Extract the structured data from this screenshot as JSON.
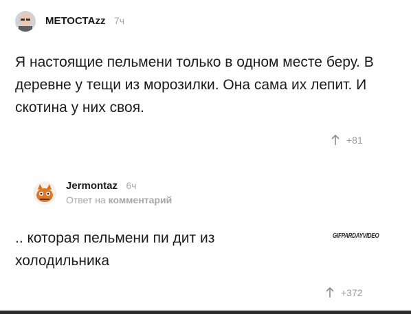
{
  "comments": [
    {
      "author": "МЕТОСТАzz",
      "time": "7ч",
      "text": "Я настоящие пельмени только в одном месте беру. В деревне у тещи из морозилки. Она сама их лепит. И скотина у них своя.",
      "votes": "+81",
      "avatar_icon": "bald-man-avatar-icon"
    },
    {
      "author": "Jermontaz",
      "time": "6ч",
      "reply_prefix": "Ответ на",
      "reply_target": "комментарий",
      "text": ".. которая пельмени пи  дит из холодильника",
      "votes": "+372",
      "avatar_icon": "cat-avatar-icon"
    }
  ],
  "watermark": "GIFPARDAYVIDEO",
  "colors": {
    "text": "#1b1b1b",
    "muted": "#a7a7a7"
  }
}
